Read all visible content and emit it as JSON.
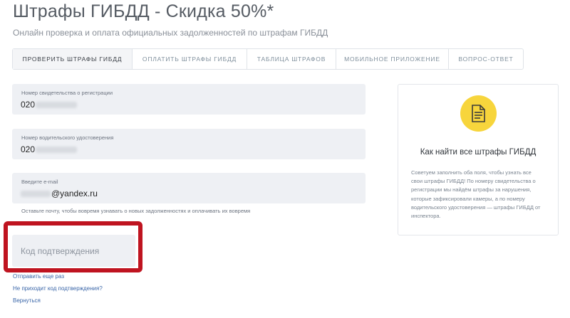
{
  "header": {
    "title": "Штрафы ГИБДД - Скидка 50%*",
    "subtitle": "Онлайн проверка и оплата официальных задолженностей по штрафам ГИБДД"
  },
  "tabs": [
    {
      "label": "ПРОВЕРИТЬ ШТРАФЫ ГИБДД",
      "active": true
    },
    {
      "label": "ОПЛАТИТЬ ШТРАФЫ ГИБДД",
      "active": false
    },
    {
      "label": "ТАБЛИЦА ШТРАФОВ",
      "active": false
    },
    {
      "label": "МОБИЛЬНОЕ ПРИЛОЖЕНИЕ",
      "active": false
    },
    {
      "label": "ВОПРОС-ОТВЕТ",
      "active": false
    }
  ],
  "form": {
    "registration": {
      "label": "Номер свидетельства о регистрации",
      "value": "020"
    },
    "license": {
      "label": "Номер водительского удостоверения",
      "value": "020"
    },
    "email": {
      "label": "Введите e-mail",
      "value": "@yandex.ru"
    },
    "email_hint": "Оставьте почту, чтобы вовремя узнавать о новых задолженностях и оплачивать их вовремя",
    "code_placeholder": "Код подтверждения",
    "resend_link": "Отправить еще раз",
    "no_code_link": "Не приходит код подтверждения?",
    "back_link": "Вернуться"
  },
  "info_card": {
    "icon": "document-icon",
    "title": "Как найти все штрафы ГИБДД",
    "text": "Советуем заполнить оба поля, чтобы узнать все свои штрафы ГИБДД! По номеру свидетельства о регистрации мы найдём штрафы за нарушения, которые зафиксировали камеры, а по номеру водительского удостоверения — штрафы ГИБДД от инспектора."
  },
  "colors": {
    "accent_yellow": "#f7d53c",
    "highlight_red": "#bf1420",
    "link_blue": "#3a66a8",
    "field_bg": "#eef0f4"
  }
}
